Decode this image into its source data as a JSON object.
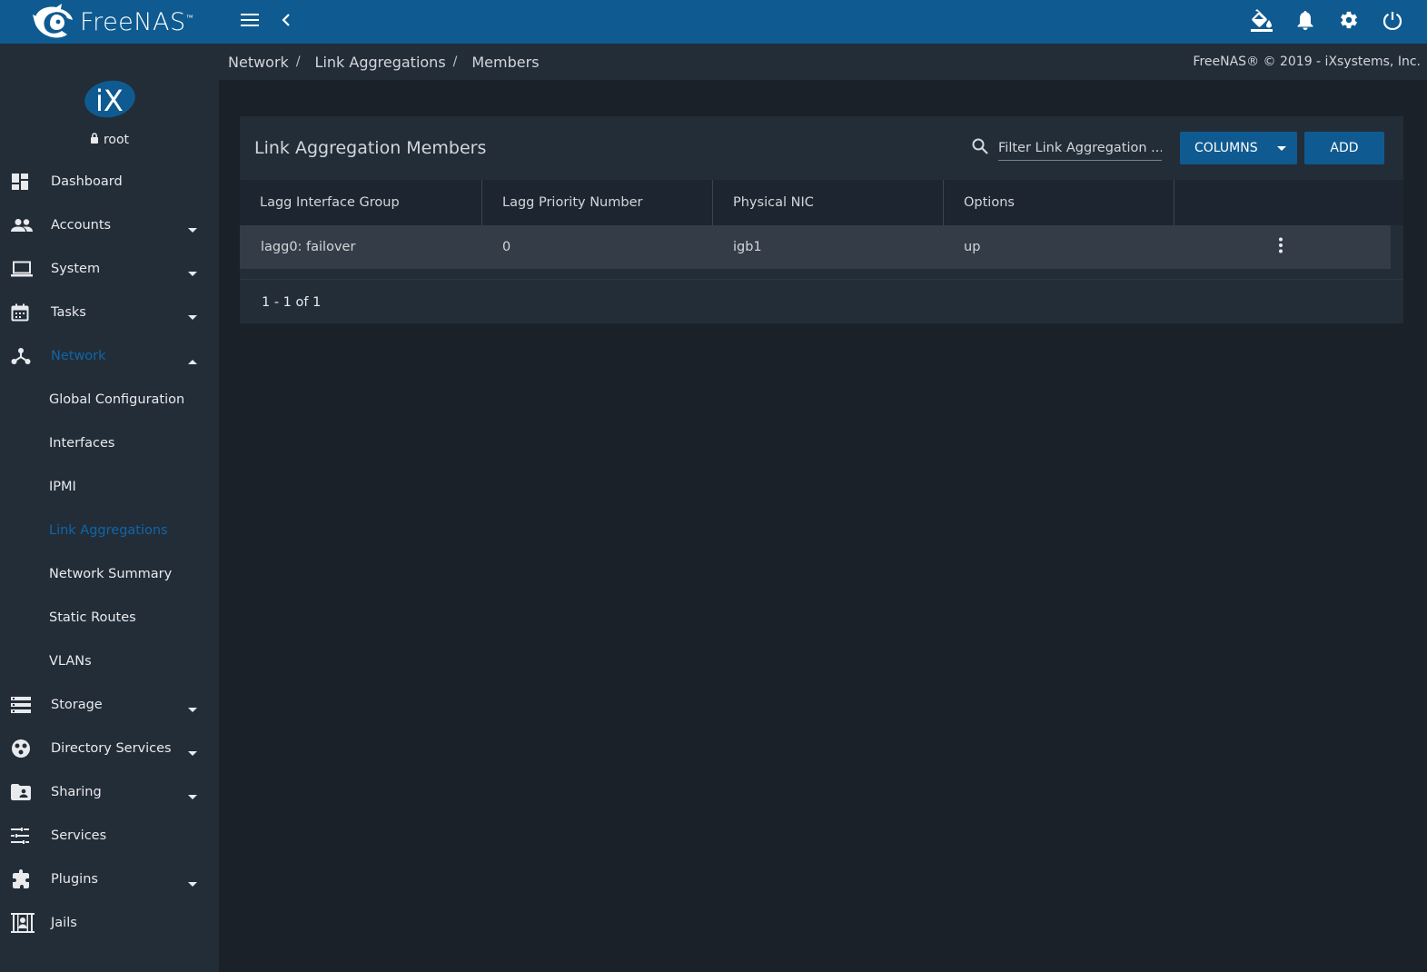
{
  "app": {
    "brand": "FreeNAS",
    "trademark": "™"
  },
  "colors": {
    "topbar": "#0f5b91",
    "sidebar": "#232d38",
    "background": "#1a2129",
    "accent": "#0f66a8",
    "row": "#343d47"
  },
  "topbar": {
    "icons": [
      "menu-icon",
      "chevron-left-icon",
      "paint-bucket-icon",
      "bell-icon",
      "gear-icon",
      "power-icon"
    ]
  },
  "profile": {
    "logo": "iX",
    "user": "root"
  },
  "sidebar": {
    "items": [
      {
        "label": "Dashboard",
        "icon": "dashboard-icon"
      },
      {
        "label": "Accounts",
        "icon": "people-icon"
      },
      {
        "label": "System",
        "icon": "laptop-icon"
      },
      {
        "label": "Tasks",
        "icon": "calendar-icon"
      },
      {
        "label": "Network",
        "icon": "network-icon"
      },
      {
        "label": "Storage",
        "icon": "storage-icon"
      },
      {
        "label": "Directory Services",
        "icon": "directory-icon"
      },
      {
        "label": "Sharing",
        "icon": "folder-shared-icon"
      },
      {
        "label": "Services",
        "icon": "tune-icon"
      },
      {
        "label": "Plugins",
        "icon": "puzzle-icon"
      },
      {
        "label": "Jails",
        "icon": "jail-icon"
      }
    ],
    "network_sub": [
      {
        "label": "Global Configuration"
      },
      {
        "label": "Interfaces"
      },
      {
        "label": "IPMI"
      },
      {
        "label": "Link Aggregations"
      },
      {
        "label": "Network Summary"
      },
      {
        "label": "Static Routes"
      },
      {
        "label": "VLANs"
      }
    ]
  },
  "breadcrumb": {
    "items": [
      "Network",
      "Link Aggregations",
      "Members"
    ],
    "separator": "/"
  },
  "copyright": "FreeNAS® © 2019 - iXsystems, Inc.",
  "card": {
    "title": "Link Aggregation Members",
    "filter_placeholder": "Filter Link Aggregation ...",
    "columns_label": "COLUMNS",
    "add_label": "ADD"
  },
  "table": {
    "headers": [
      "Lagg Interface Group",
      "Lagg Priority Number",
      "Physical NIC",
      "Options"
    ],
    "rows": [
      [
        "lagg0: failover",
        "0",
        "igb1",
        "up"
      ]
    ],
    "paginator": "1 - 1 of 1"
  }
}
